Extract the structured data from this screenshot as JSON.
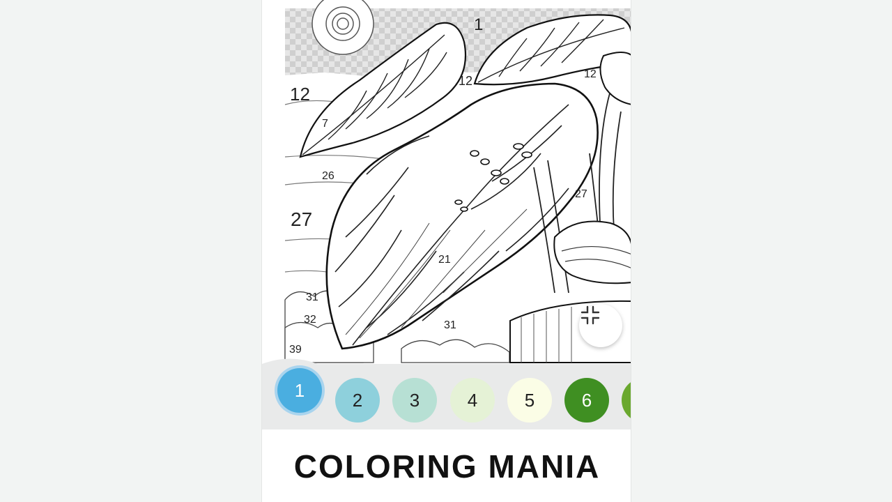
{
  "app": {
    "title": "COLORING MANIA"
  },
  "canvas": {
    "region_numbers": [
      {
        "id": "n1",
        "label": "1"
      },
      {
        "id": "n12a",
        "label": "12"
      },
      {
        "id": "n12b",
        "label": "12"
      },
      {
        "id": "n12c",
        "label": "12"
      },
      {
        "id": "n7",
        "label": "7"
      },
      {
        "id": "n26",
        "label": "26"
      },
      {
        "id": "n27a",
        "label": "27"
      },
      {
        "id": "n27b",
        "label": "27"
      },
      {
        "id": "n21",
        "label": "21"
      },
      {
        "id": "n31a",
        "label": "31"
      },
      {
        "id": "n31b",
        "label": "31"
      },
      {
        "id": "n32",
        "label": "32"
      },
      {
        "id": "n39",
        "label": "39"
      }
    ],
    "shrink_icon": "collapse-arrows-icon"
  },
  "palette": {
    "selected_index": 0,
    "swatches": [
      {
        "label": "1",
        "color": "#4aaee0"
      },
      {
        "label": "2",
        "color": "#8ed0dc"
      },
      {
        "label": "3",
        "color": "#b7e0d4"
      },
      {
        "label": "4",
        "color": "#e5f2d6"
      },
      {
        "label": "5",
        "color": "#fbfde6"
      },
      {
        "label": "6",
        "color": "#3f8f22"
      },
      {
        "label": "",
        "color": "#6aa82e"
      }
    ]
  }
}
